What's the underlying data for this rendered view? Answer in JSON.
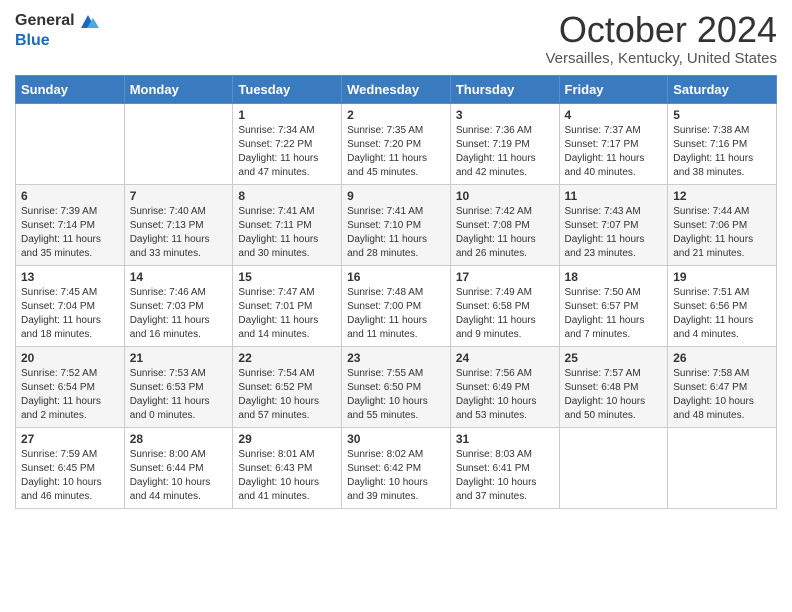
{
  "header": {
    "logo_general": "General",
    "logo_blue": "Blue",
    "month_title": "October 2024",
    "location": "Versailles, Kentucky, United States"
  },
  "days_of_week": [
    "Sunday",
    "Monday",
    "Tuesday",
    "Wednesday",
    "Thursday",
    "Friday",
    "Saturday"
  ],
  "weeks": [
    [
      {
        "day": "",
        "info": ""
      },
      {
        "day": "",
        "info": ""
      },
      {
        "day": "1",
        "info": "Sunrise: 7:34 AM\nSunset: 7:22 PM\nDaylight: 11 hours and 47 minutes."
      },
      {
        "day": "2",
        "info": "Sunrise: 7:35 AM\nSunset: 7:20 PM\nDaylight: 11 hours and 45 minutes."
      },
      {
        "day": "3",
        "info": "Sunrise: 7:36 AM\nSunset: 7:19 PM\nDaylight: 11 hours and 42 minutes."
      },
      {
        "day": "4",
        "info": "Sunrise: 7:37 AM\nSunset: 7:17 PM\nDaylight: 11 hours and 40 minutes."
      },
      {
        "day": "5",
        "info": "Sunrise: 7:38 AM\nSunset: 7:16 PM\nDaylight: 11 hours and 38 minutes."
      }
    ],
    [
      {
        "day": "6",
        "info": "Sunrise: 7:39 AM\nSunset: 7:14 PM\nDaylight: 11 hours and 35 minutes."
      },
      {
        "day": "7",
        "info": "Sunrise: 7:40 AM\nSunset: 7:13 PM\nDaylight: 11 hours and 33 minutes."
      },
      {
        "day": "8",
        "info": "Sunrise: 7:41 AM\nSunset: 7:11 PM\nDaylight: 11 hours and 30 minutes."
      },
      {
        "day": "9",
        "info": "Sunrise: 7:41 AM\nSunset: 7:10 PM\nDaylight: 11 hours and 28 minutes."
      },
      {
        "day": "10",
        "info": "Sunrise: 7:42 AM\nSunset: 7:08 PM\nDaylight: 11 hours and 26 minutes."
      },
      {
        "day": "11",
        "info": "Sunrise: 7:43 AM\nSunset: 7:07 PM\nDaylight: 11 hours and 23 minutes."
      },
      {
        "day": "12",
        "info": "Sunrise: 7:44 AM\nSunset: 7:06 PM\nDaylight: 11 hours and 21 minutes."
      }
    ],
    [
      {
        "day": "13",
        "info": "Sunrise: 7:45 AM\nSunset: 7:04 PM\nDaylight: 11 hours and 18 minutes."
      },
      {
        "day": "14",
        "info": "Sunrise: 7:46 AM\nSunset: 7:03 PM\nDaylight: 11 hours and 16 minutes."
      },
      {
        "day": "15",
        "info": "Sunrise: 7:47 AM\nSunset: 7:01 PM\nDaylight: 11 hours and 14 minutes."
      },
      {
        "day": "16",
        "info": "Sunrise: 7:48 AM\nSunset: 7:00 PM\nDaylight: 11 hours and 11 minutes."
      },
      {
        "day": "17",
        "info": "Sunrise: 7:49 AM\nSunset: 6:58 PM\nDaylight: 11 hours and 9 minutes."
      },
      {
        "day": "18",
        "info": "Sunrise: 7:50 AM\nSunset: 6:57 PM\nDaylight: 11 hours and 7 minutes."
      },
      {
        "day": "19",
        "info": "Sunrise: 7:51 AM\nSunset: 6:56 PM\nDaylight: 11 hours and 4 minutes."
      }
    ],
    [
      {
        "day": "20",
        "info": "Sunrise: 7:52 AM\nSunset: 6:54 PM\nDaylight: 11 hours and 2 minutes."
      },
      {
        "day": "21",
        "info": "Sunrise: 7:53 AM\nSunset: 6:53 PM\nDaylight: 11 hours and 0 minutes."
      },
      {
        "day": "22",
        "info": "Sunrise: 7:54 AM\nSunset: 6:52 PM\nDaylight: 10 hours and 57 minutes."
      },
      {
        "day": "23",
        "info": "Sunrise: 7:55 AM\nSunset: 6:50 PM\nDaylight: 10 hours and 55 minutes."
      },
      {
        "day": "24",
        "info": "Sunrise: 7:56 AM\nSunset: 6:49 PM\nDaylight: 10 hours and 53 minutes."
      },
      {
        "day": "25",
        "info": "Sunrise: 7:57 AM\nSunset: 6:48 PM\nDaylight: 10 hours and 50 minutes."
      },
      {
        "day": "26",
        "info": "Sunrise: 7:58 AM\nSunset: 6:47 PM\nDaylight: 10 hours and 48 minutes."
      }
    ],
    [
      {
        "day": "27",
        "info": "Sunrise: 7:59 AM\nSunset: 6:45 PM\nDaylight: 10 hours and 46 minutes."
      },
      {
        "day": "28",
        "info": "Sunrise: 8:00 AM\nSunset: 6:44 PM\nDaylight: 10 hours and 44 minutes."
      },
      {
        "day": "29",
        "info": "Sunrise: 8:01 AM\nSunset: 6:43 PM\nDaylight: 10 hours and 41 minutes."
      },
      {
        "day": "30",
        "info": "Sunrise: 8:02 AM\nSunset: 6:42 PM\nDaylight: 10 hours and 39 minutes."
      },
      {
        "day": "31",
        "info": "Sunrise: 8:03 AM\nSunset: 6:41 PM\nDaylight: 10 hours and 37 minutes."
      },
      {
        "day": "",
        "info": ""
      },
      {
        "day": "",
        "info": ""
      }
    ]
  ]
}
